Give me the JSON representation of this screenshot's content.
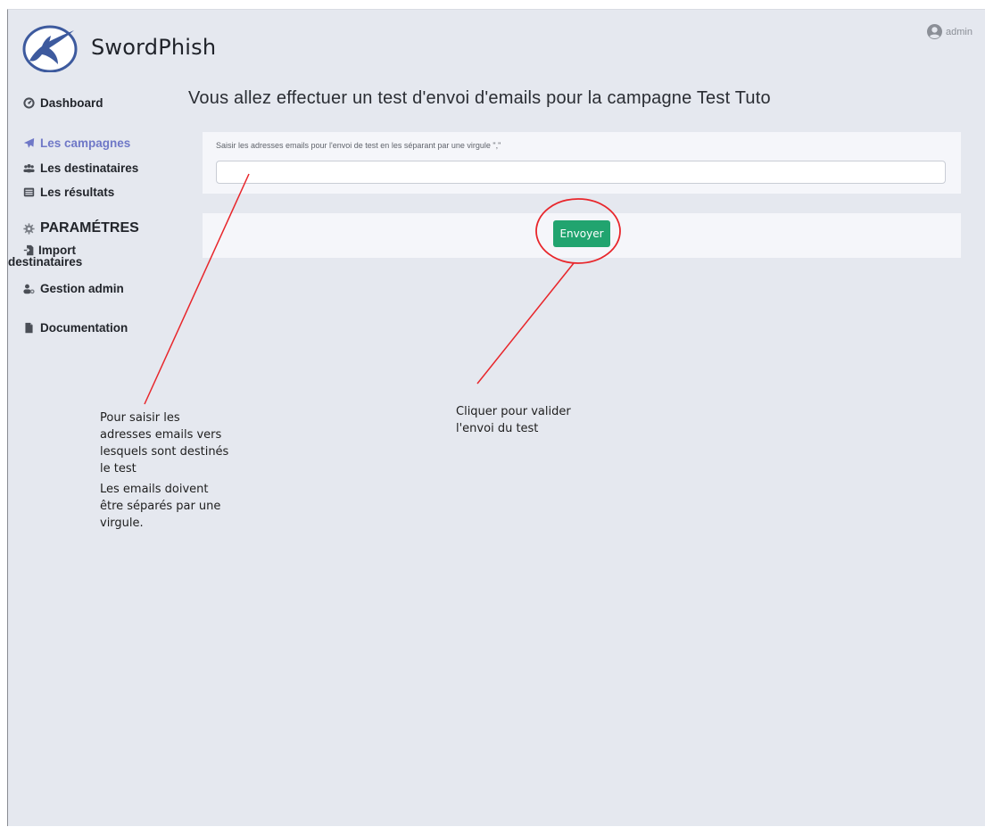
{
  "header": {
    "brand": "SwordPhish",
    "user_label": "admin"
  },
  "sidebar": {
    "dashboard": "Dashboard",
    "campaigns": "Les campagnes",
    "recipients": "Les destinataires",
    "results": "Les résultats",
    "settings_section": "PARAMÉTRES",
    "import_line1": "Import",
    "import_line2": "destinataires",
    "admin_management": "Gestion admin",
    "documentation": "Documentation"
  },
  "main": {
    "title": "Vous allez effectuer un test d'envoi d'emails pour la campagne Test Tuto",
    "email_label": "Saisir les adresses emails pour l'envoi de test en les séparant par une virgule \",\"",
    "email_value": "",
    "send_button": "Envoyer"
  },
  "annotations": {
    "left_p1": [
      "Pour saisir les",
      "adresses emails vers",
      "lesquels sont destinés",
      "le test"
    ],
    "left_p2": [
      "Les emails doivent",
      "être séparés par une",
      "virgule."
    ],
    "right": [
      "Cliquer pour valider",
      "l'envoi du test"
    ]
  },
  "colors": {
    "background": "#e5e8ef",
    "card": "#f5f6fa",
    "accent_active": "#6f78c7",
    "button": "#21a46f",
    "annotation_line": "#e8262b"
  },
  "icons": {
    "logo": "swordfish-logo",
    "user": "user-circle-icon",
    "dashboard": "gauge-icon",
    "campaigns": "paper-plane-icon",
    "recipients": "users-icon",
    "results": "list-icon",
    "settings": "gear-icon",
    "import": "file-import-icon",
    "admin": "users-gear-icon",
    "documentation": "file-icon"
  }
}
